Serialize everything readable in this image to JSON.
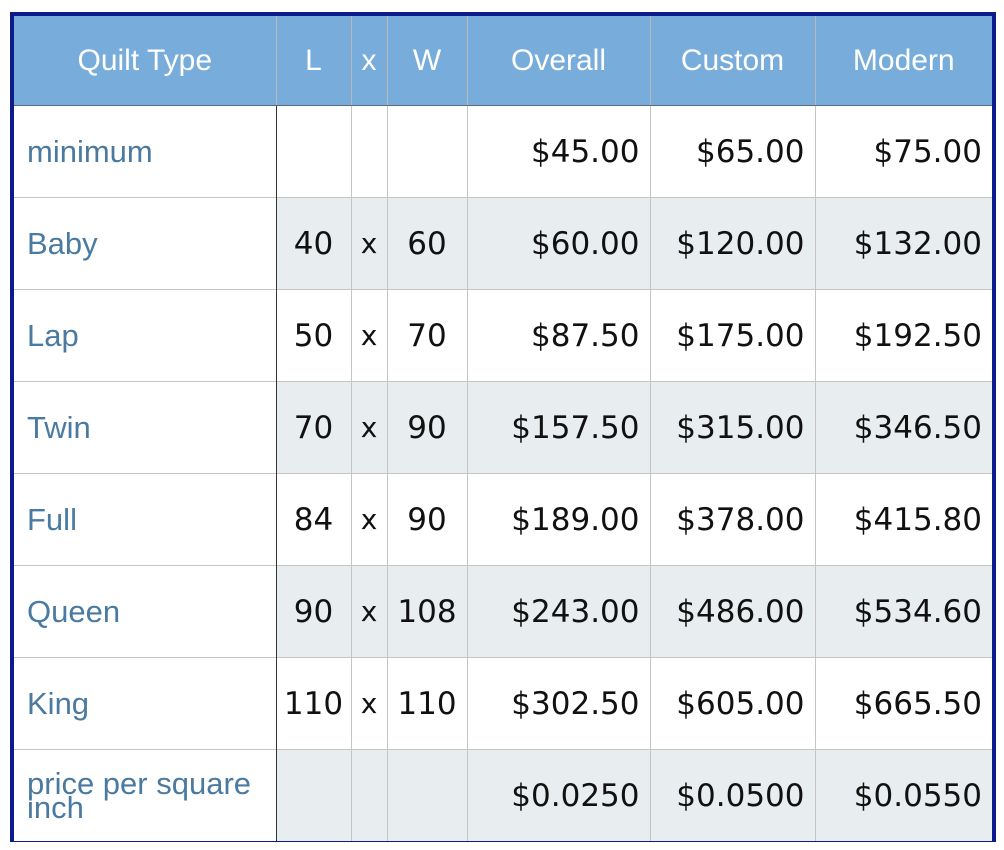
{
  "table": {
    "headers": {
      "type": "Quilt Type",
      "l": "L",
      "x": "x",
      "w": "W",
      "overall": "Overall",
      "custom": "Custom",
      "modern": "Modern"
    },
    "rows": [
      {
        "type": "minimum",
        "l": "",
        "x": "",
        "w": "",
        "overall": "$45.00",
        "custom": "$65.00",
        "modern": "$75.00"
      },
      {
        "type": "Baby",
        "l": "40",
        "x": "x",
        "w": "60",
        "overall": "$60.00",
        "custom": "$120.00",
        "modern": "$132.00"
      },
      {
        "type": "Lap",
        "l": "50",
        "x": "x",
        "w": "70",
        "overall": "$87.50",
        "custom": "$175.00",
        "modern": "$192.50"
      },
      {
        "type": "Twin",
        "l": "70",
        "x": "x",
        "w": "90",
        "overall": "$157.50",
        "custom": "$315.00",
        "modern": "$346.50"
      },
      {
        "type": "Full",
        "l": "84",
        "x": "x",
        "w": "90",
        "overall": "$189.00",
        "custom": "$378.00",
        "modern": "$415.80"
      },
      {
        "type": "Queen",
        "l": "90",
        "x": "x",
        "w": "108",
        "overall": "$243.00",
        "custom": "$486.00",
        "modern": "$534.60"
      },
      {
        "type": "King",
        "l": "110",
        "x": "x",
        "w": "110",
        "overall": "$302.50",
        "custom": "$605.00",
        "modern": "$665.50"
      },
      {
        "type": "price per square inch",
        "l": "",
        "x": "",
        "w": "",
        "overall": "$0.0250",
        "custom": "$0.0500",
        "modern": "$0.0550"
      }
    ]
  },
  "colors": {
    "header_bg": "#78addb",
    "header_text": "#ffffff",
    "frame_border": "#0b1b8c",
    "label_text": "#4a7aa0",
    "alt_row_bg": "#e8edf0"
  }
}
